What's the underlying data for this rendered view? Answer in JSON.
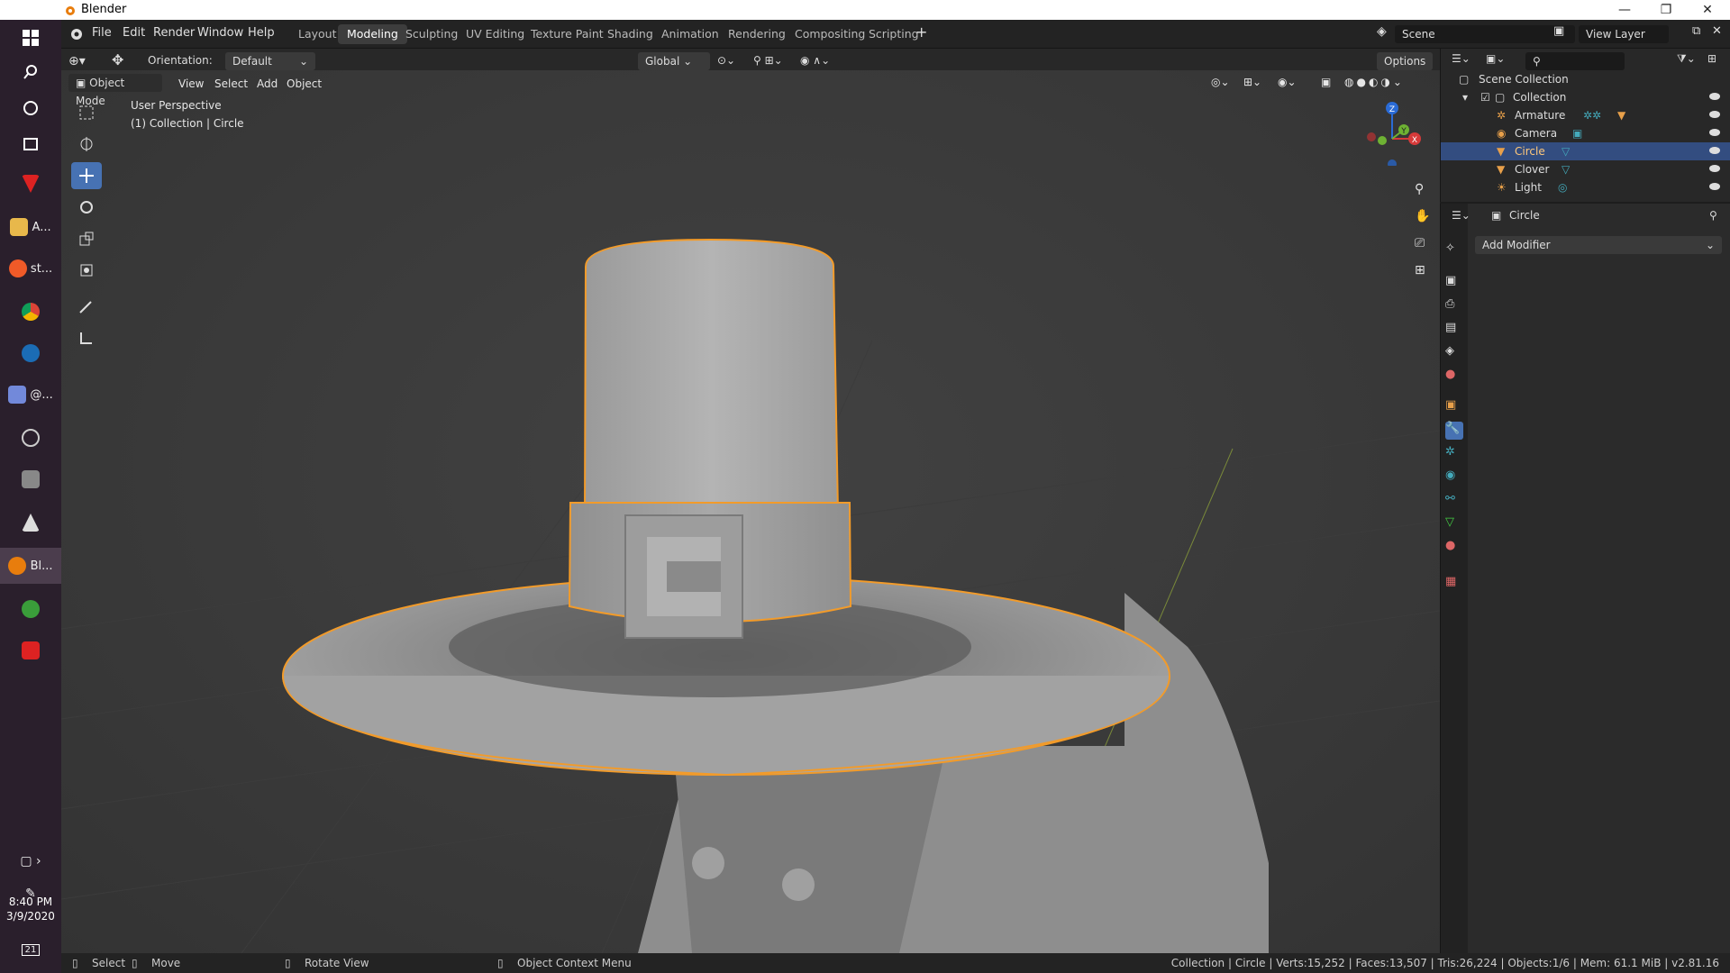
{
  "window": {
    "title": "Blender"
  },
  "taskbar": {
    "items": [
      {
        "label": "A..."
      },
      {
        "label": "st..."
      },
      {
        "label": "@..."
      },
      {
        "label": "Bl..."
      }
    ],
    "time": "8:40 PM",
    "date": "3/9/2020",
    "notification_count": "21"
  },
  "menu": [
    "File",
    "Edit",
    "Render",
    "Window",
    "Help"
  ],
  "workspaces": [
    "Layout",
    "Modeling",
    "Sculpting",
    "UV Editing",
    "Texture Paint",
    "Shading",
    "Animation",
    "Rendering",
    "Compositing",
    "Scripting"
  ],
  "active_workspace": "Modeling",
  "scene": {
    "name": "Scene",
    "view_layer": "View Layer"
  },
  "header": {
    "orientation_label": "Orientation:",
    "orientation_value": "Default",
    "transform_space": "Global",
    "options": "Options"
  },
  "viewport_header": {
    "mode": "Object Mode",
    "menus": [
      "View",
      "Select",
      "Add",
      "Object"
    ]
  },
  "viewport": {
    "overlay_line1": "User Perspective",
    "overlay_line2": "(1) Collection | Circle",
    "gizmo_axes": [
      "Z",
      "Y",
      "X"
    ]
  },
  "outliner": {
    "root": "Scene Collection",
    "collection": "Collection",
    "objects": [
      "Armature",
      "Camera",
      "Circle",
      "Clover",
      "Light"
    ],
    "selected": "Circle"
  },
  "properties": {
    "object_name": "Circle",
    "add_modifier": "Add Modifier"
  },
  "statusbar": {
    "select": "Select",
    "move": "Move",
    "rotate": "Rotate View",
    "context": "Object Context Menu",
    "stats": "Collection | Circle | Verts:15,252 | Faces:13,507 | Tris:26,224 | Objects:1/6 | Mem: 61.1 MiB | v2.81.16"
  },
  "colors": {
    "accent": "#4772b3",
    "selection_outline": "#f29b2a",
    "outliner_selected": "#334d80"
  }
}
